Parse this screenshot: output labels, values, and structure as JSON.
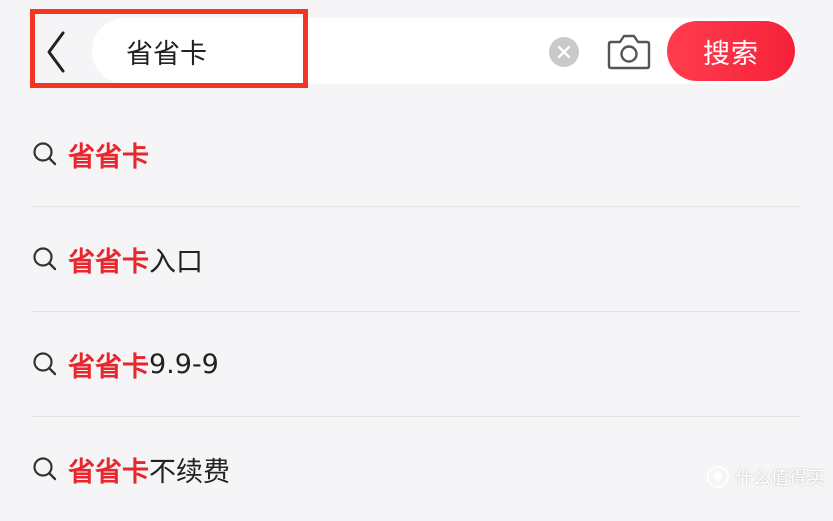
{
  "header": {
    "search_value": "省省卡",
    "search_button_label": "搜索"
  },
  "suggestions": [
    {
      "highlight": "省省卡",
      "rest": ""
    },
    {
      "highlight": "省省卡",
      "rest": "入口"
    },
    {
      "highlight": "省省卡",
      "rest": "9.9-9"
    },
    {
      "highlight": "省省卡",
      "rest": "不续费"
    }
  ],
  "watermark": {
    "text": "什么值得买"
  },
  "colors": {
    "accent": "#f5213a",
    "highlight_text": "#e8262e",
    "annotation_border": "#f23622",
    "background": "#f5f5f7"
  },
  "icons": {
    "back": "chevron-left-icon",
    "clear": "clear-circle-icon",
    "camera": "camera-icon",
    "suggestion": "search-icon"
  }
}
